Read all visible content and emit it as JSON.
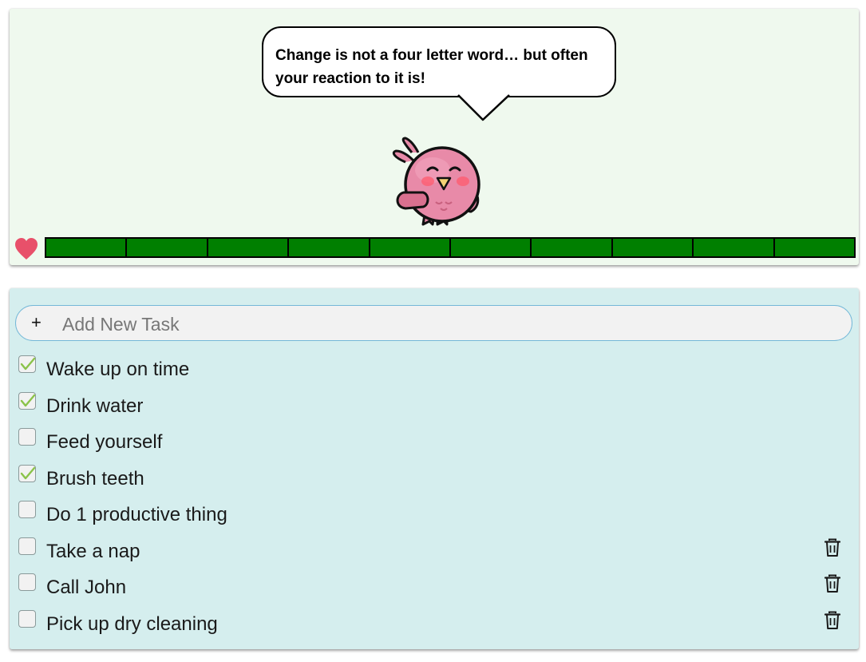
{
  "pet": {
    "quote": "Change is not a four letter word… but often your reaction to it is!",
    "health_segments": 10,
    "health_filled": 10,
    "health_color": "#007f00",
    "heart_color": "#e8506a",
    "bird_color": "#e88aa8"
  },
  "add_task": {
    "icon": "plus-icon",
    "plus_symbol": "+",
    "placeholder": "Add New Task"
  },
  "tasks": [
    {
      "label": "Wake up on time",
      "checked": true,
      "deletable": false
    },
    {
      "label": "Drink water",
      "checked": true,
      "deletable": false
    },
    {
      "label": "Feed yourself",
      "checked": false,
      "deletable": false
    },
    {
      "label": "Brush teeth",
      "checked": true,
      "deletable": false
    },
    {
      "label": "Do 1 productive thing",
      "checked": false,
      "deletable": false
    },
    {
      "label": "Take a nap",
      "checked": false,
      "deletable": true
    },
    {
      "label": "Call John",
      "checked": false,
      "deletable": true
    },
    {
      "label": "Pick up dry cleaning",
      "checked": false,
      "deletable": true
    }
  ],
  "colors": {
    "pet_panel_bg": "#eff9ee",
    "todo_panel_bg": "#d5eeee",
    "check_color": "#8bc34a"
  }
}
